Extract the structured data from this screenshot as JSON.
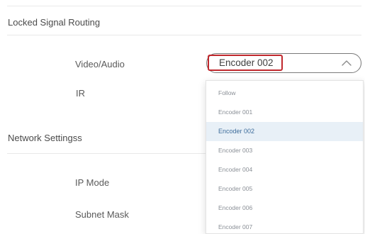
{
  "locked_signal_routing": {
    "title": "Locked Signal Routing",
    "video_audio_label": "Video/Audio",
    "ir_label": "IR",
    "selected_value": "Encoder 002"
  },
  "network_settings": {
    "title": "Network Settingss",
    "ip_mode_label": "IP Mode",
    "subnet_mask_label": "Subnet Mask"
  },
  "dropdown": {
    "options": [
      "Follow",
      "Encoder 001",
      "Encoder 002",
      "Encoder 003",
      "Encoder 004",
      "Encoder 005",
      "Encoder 006",
      "Encoder 007"
    ],
    "selected_index": 2
  },
  "colors": {
    "highlight_border": "#c0282d",
    "selected_bg": "#e8f0f7",
    "selected_text": "#3e6d9b"
  }
}
